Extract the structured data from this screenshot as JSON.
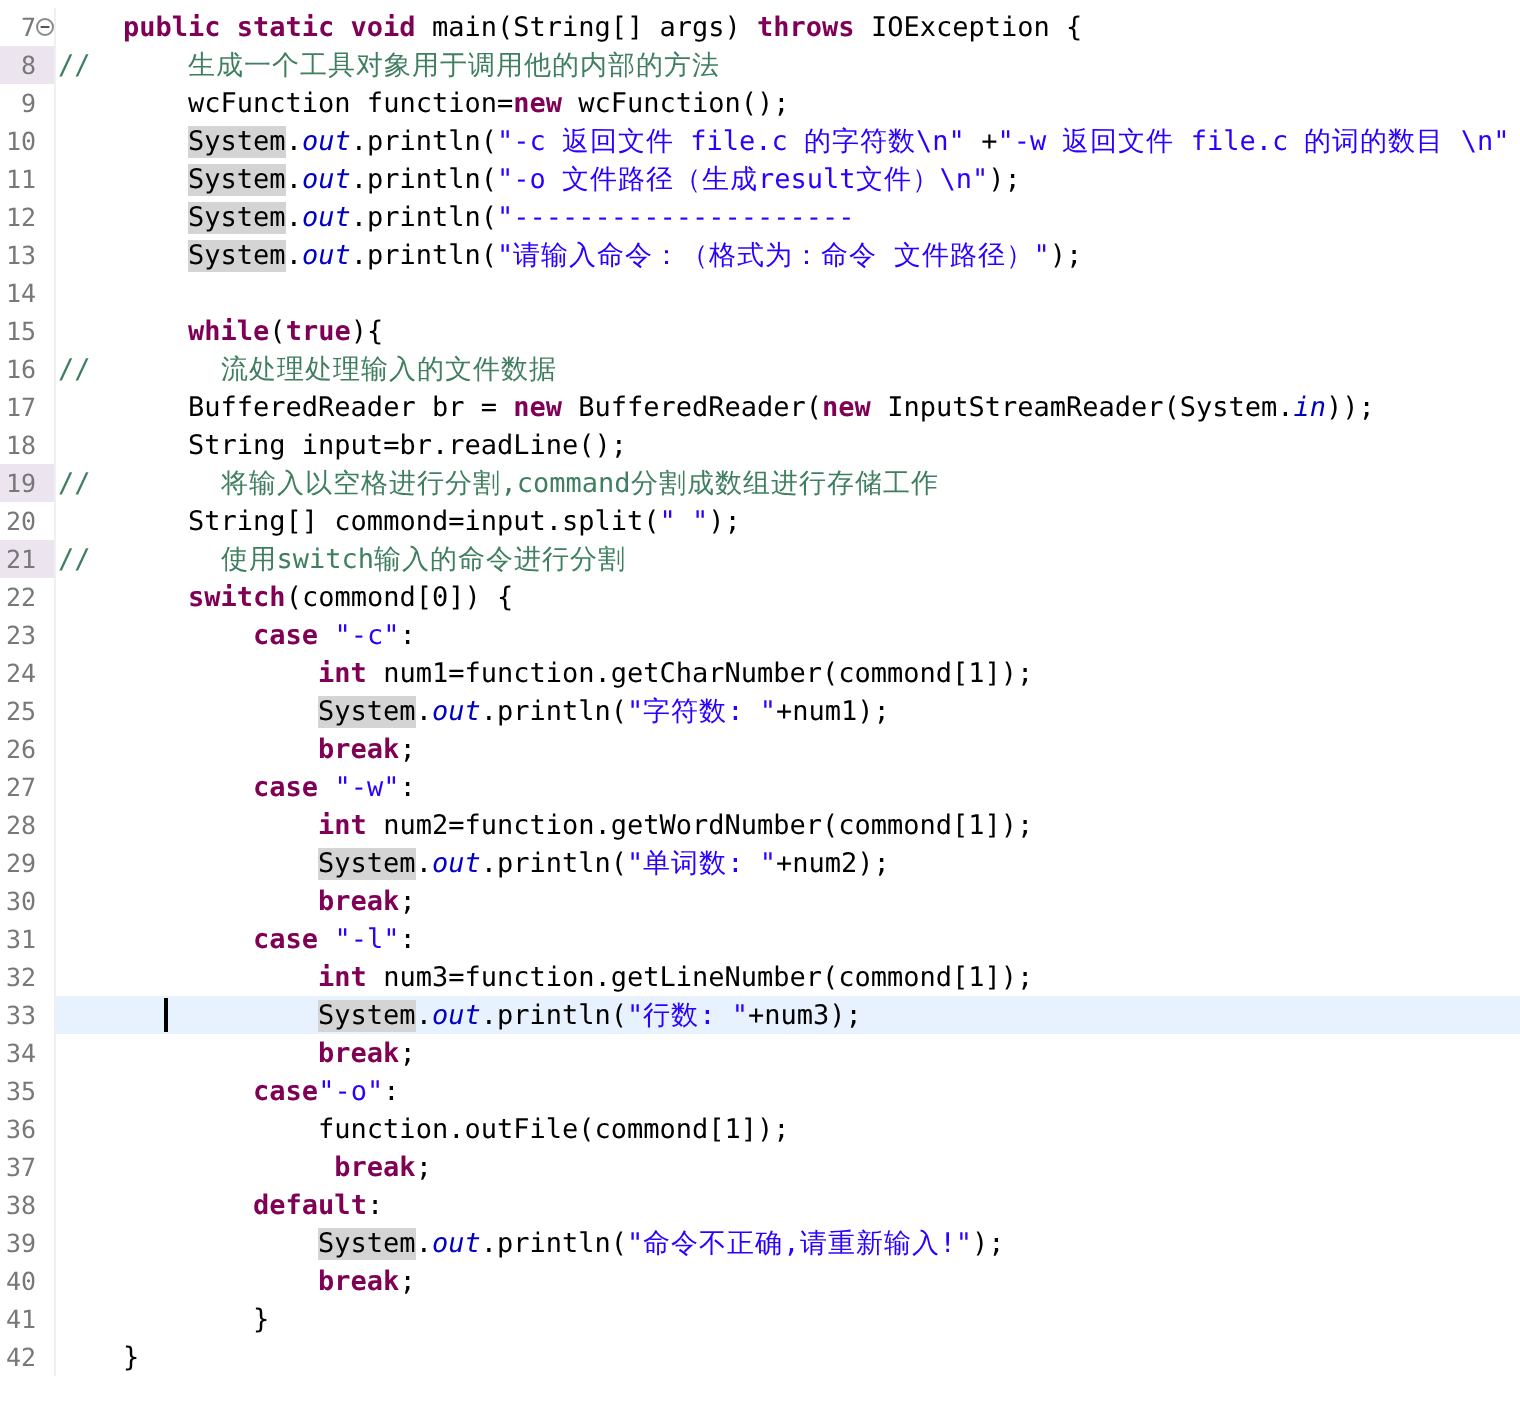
{
  "editor": {
    "lines": [
      {
        "number": "7",
        "current": false,
        "changed": false,
        "foldable": true,
        "tokens": [
          {
            "kind": "kw",
            "text": "    public static void"
          },
          {
            "kind": "plain",
            "text": " main(String[] args) "
          },
          {
            "kind": "kw",
            "text": "throws"
          },
          {
            "kind": "plain",
            "text": " IOException {"
          }
        ]
      },
      {
        "number": "8",
        "current": false,
        "changed": true,
        "foldable": false,
        "tokens": [
          {
            "kind": "comment",
            "text": "//      生成一个工具对象用于调用他的内部的方法"
          }
        ]
      },
      {
        "number": "9",
        "current": false,
        "changed": false,
        "foldable": false,
        "tokens": [
          {
            "kind": "plain",
            "text": "        wcFunction function="
          },
          {
            "kind": "kw",
            "text": "new"
          },
          {
            "kind": "plain",
            "text": " wcFunction();"
          }
        ]
      },
      {
        "number": "10",
        "current": false,
        "changed": false,
        "foldable": false,
        "tokens": [
          {
            "kind": "mark",
            "text": "        System"
          },
          {
            "kind": "plain",
            "text": "."
          },
          {
            "kind": "field",
            "text": "out"
          },
          {
            "kind": "plain",
            "text": ".println("
          },
          {
            "kind": "str",
            "text": "\"-c 返回文件 file.c 的字符数\\n\""
          },
          {
            "kind": "plain",
            "text": " +"
          },
          {
            "kind": "str",
            "text": "\"-w 返回文件 file.c 的词的数目 \\n\""
          }
        ]
      },
      {
        "number": "11",
        "current": false,
        "changed": false,
        "foldable": false,
        "tokens": [
          {
            "kind": "mark",
            "text": "        System"
          },
          {
            "kind": "plain",
            "text": "."
          },
          {
            "kind": "field",
            "text": "out"
          },
          {
            "kind": "plain",
            "text": ".println("
          },
          {
            "kind": "str",
            "text": "\"-o 文件路径（生成result文件）\\n\""
          },
          {
            "kind": "plain",
            "text": ");"
          }
        ]
      },
      {
        "number": "12",
        "current": false,
        "changed": false,
        "foldable": false,
        "tokens": [
          {
            "kind": "mark",
            "text": "        System"
          },
          {
            "kind": "plain",
            "text": "."
          },
          {
            "kind": "field",
            "text": "out"
          },
          {
            "kind": "plain",
            "text": ".println("
          },
          {
            "kind": "str",
            "text": "\"---------------------"
          }
        ]
      },
      {
        "number": "13",
        "current": false,
        "changed": false,
        "foldable": false,
        "tokens": [
          {
            "kind": "mark",
            "text": "        System"
          },
          {
            "kind": "plain",
            "text": "."
          },
          {
            "kind": "field",
            "text": "out"
          },
          {
            "kind": "plain",
            "text": ".println("
          },
          {
            "kind": "str",
            "text": "\"请输入命令：（格式为：命令 文件路径）\""
          },
          {
            "kind": "plain",
            "text": ");"
          }
        ]
      },
      {
        "number": "14",
        "current": false,
        "changed": false,
        "foldable": false
      },
      {
        "number": "15",
        "current": false,
        "changed": false,
        "foldable": false,
        "tokens": [
          {
            "kind": "kw",
            "text": "        while"
          },
          {
            "kind": "plain",
            "text": "("
          },
          {
            "kind": "kw",
            "text": "true"
          },
          {
            "kind": "plain",
            "text": "){"
          }
        ]
      },
      {
        "number": "16",
        "current": false,
        "changed": false,
        "foldable": false,
        "tokens": [
          {
            "kind": "comment",
            "text": "//        流处理处理输入的文件数据"
          }
        ]
      },
      {
        "number": "17",
        "current": false,
        "changed": false,
        "foldable": false,
        "tokens": [
          {
            "kind": "plain",
            "text": "        BufferedReader br = "
          },
          {
            "kind": "kw",
            "text": "new"
          },
          {
            "kind": "plain",
            "text": " BufferedReader("
          },
          {
            "kind": "kw",
            "text": "new"
          },
          {
            "kind": "plain",
            "text": " InputStreamReader(System."
          },
          {
            "kind": "field",
            "text": "in"
          },
          {
            "kind": "plain",
            "text": "));"
          }
        ]
      },
      {
        "number": "18",
        "current": false,
        "changed": false,
        "foldable": false,
        "tokens": [
          {
            "kind": "plain",
            "text": "        String input=br.readLine();"
          }
        ]
      },
      {
        "number": "19",
        "current": false,
        "changed": true,
        "foldable": false,
        "tokens": [
          {
            "kind": "comment",
            "text": "//        将输入以空格进行分割,command分割成数组进行存储工作"
          }
        ]
      },
      {
        "number": "20",
        "current": false,
        "changed": false,
        "foldable": false,
        "tokens": [
          {
            "kind": "plain",
            "text": "        String[] commond=input.split("
          },
          {
            "kind": "str",
            "text": "\" \""
          },
          {
            "kind": "plain",
            "text": ");"
          }
        ]
      },
      {
        "number": "21",
        "current": false,
        "changed": true,
        "foldable": false,
        "tokens": [
          {
            "kind": "comment",
            "text": "//        使用switch输入的命令进行分割"
          }
        ]
      },
      {
        "number": "22",
        "current": false,
        "changed": false,
        "foldable": false,
        "tokens": [
          {
            "kind": "kw",
            "text": "        switch"
          },
          {
            "kind": "plain",
            "text": "(commond[0]) {"
          }
        ]
      },
      {
        "number": "23",
        "current": false,
        "changed": false,
        "foldable": false,
        "tokens": [
          {
            "kind": "kw",
            "text": "            case"
          },
          {
            "kind": "str",
            "text": " \"-c\""
          },
          {
            "kind": "plain",
            "text": ":"
          }
        ]
      },
      {
        "number": "24",
        "current": false,
        "changed": false,
        "foldable": false,
        "tokens": [
          {
            "kind": "kw",
            "text": "                int"
          },
          {
            "kind": "plain",
            "text": " num1=function.getCharNumber(commond[1]);"
          }
        ]
      },
      {
        "number": "25",
        "current": false,
        "changed": false,
        "foldable": false,
        "tokens": [
          {
            "kind": "mark",
            "text": "                System"
          },
          {
            "kind": "plain",
            "text": "."
          },
          {
            "kind": "field",
            "text": "out"
          },
          {
            "kind": "plain",
            "text": ".println("
          },
          {
            "kind": "str",
            "text": "\"字符数: \""
          },
          {
            "kind": "plain",
            "text": "+num1);"
          }
        ]
      },
      {
        "number": "26",
        "current": false,
        "changed": false,
        "foldable": false,
        "tokens": [
          {
            "kind": "kw",
            "text": "                break"
          },
          {
            "kind": "plain",
            "text": ";"
          }
        ]
      },
      {
        "number": "27",
        "current": false,
        "changed": false,
        "foldable": false,
        "tokens": [
          {
            "kind": "kw",
            "text": "            case"
          },
          {
            "kind": "str",
            "text": " \"-w\""
          },
          {
            "kind": "plain",
            "text": ":"
          }
        ]
      },
      {
        "number": "28",
        "current": false,
        "changed": false,
        "foldable": false,
        "tokens": [
          {
            "kind": "kw",
            "text": "                int"
          },
          {
            "kind": "plain",
            "text": " num2=function.getWordNumber(commond[1]);"
          }
        ]
      },
      {
        "number": "29",
        "current": false,
        "changed": false,
        "foldable": false,
        "tokens": [
          {
            "kind": "mark",
            "text": "                System"
          },
          {
            "kind": "plain",
            "text": "."
          },
          {
            "kind": "field",
            "text": "out"
          },
          {
            "kind": "plain",
            "text": ".println("
          },
          {
            "kind": "str",
            "text": "\"单词数: \""
          },
          {
            "kind": "plain",
            "text": "+num2);"
          }
        ]
      },
      {
        "number": "30",
        "current": false,
        "changed": false,
        "foldable": false,
        "tokens": [
          {
            "kind": "kw",
            "text": "                break"
          },
          {
            "kind": "plain",
            "text": ";"
          }
        ]
      },
      {
        "number": "31",
        "current": false,
        "changed": false,
        "foldable": false,
        "tokens": [
          {
            "kind": "kw",
            "text": "            case"
          },
          {
            "kind": "str",
            "text": " \"-l\""
          },
          {
            "kind": "plain",
            "text": ":"
          }
        ]
      },
      {
        "number": "32",
        "current": false,
        "changed": false,
        "foldable": false,
        "tokens": [
          {
            "kind": "kw",
            "text": "                int"
          },
          {
            "kind": "plain",
            "text": " num3=function.getLineNumber(commond[1]);"
          }
        ]
      },
      {
        "number": "33",
        "current": true,
        "changed": false,
        "foldable": false,
        "tokens": [
          {
            "kind": "mark",
            "text": "                System"
          },
          {
            "kind": "plain",
            "text": "."
          },
          {
            "kind": "field",
            "text": "out"
          },
          {
            "kind": "plain",
            "text": ".println("
          },
          {
            "kind": "str",
            "text": "\"行数: \""
          },
          {
            "kind": "plain",
            "text": "+num3);"
          }
        ]
      },
      {
        "number": "34",
        "current": false,
        "changed": false,
        "foldable": false,
        "tokens": [
          {
            "kind": "kw",
            "text": "                break"
          },
          {
            "kind": "plain",
            "text": ";"
          }
        ]
      },
      {
        "number": "35",
        "current": false,
        "changed": false,
        "foldable": false,
        "tokens": [
          {
            "kind": "kw",
            "text": "            case"
          },
          {
            "kind": "str",
            "text": "\"-o\""
          },
          {
            "kind": "plain",
            "text": ":"
          }
        ]
      },
      {
        "number": "36",
        "current": false,
        "changed": false,
        "foldable": false,
        "tokens": [
          {
            "kind": "plain",
            "text": "                function.outFile(commond[1]);"
          }
        ]
      },
      {
        "number": "37",
        "current": false,
        "changed": false,
        "foldable": false,
        "tokens": [
          {
            "kind": "kw",
            "text": "                 break"
          },
          {
            "kind": "plain",
            "text": ";"
          }
        ]
      },
      {
        "number": "38",
        "current": false,
        "changed": false,
        "foldable": false,
        "tokens": [
          {
            "kind": "kw",
            "text": "            default"
          },
          {
            "kind": "plain",
            "text": ":"
          }
        ]
      },
      {
        "number": "39",
        "current": false,
        "changed": false,
        "foldable": false,
        "tokens": [
          {
            "kind": "mark",
            "text": "                System"
          },
          {
            "kind": "plain",
            "text": "."
          },
          {
            "kind": "field",
            "text": "out"
          },
          {
            "kind": "plain",
            "text": ".println("
          },
          {
            "kind": "str",
            "text": "\"命令不正确,请重新输入!\""
          },
          {
            "kind": "plain",
            "text": ");"
          }
        ]
      },
      {
        "number": "40",
        "current": false,
        "changed": false,
        "foldable": false,
        "tokens": [
          {
            "kind": "kw",
            "text": "                break"
          },
          {
            "kind": "plain",
            "text": ";"
          }
        ]
      },
      {
        "number": "41",
        "current": false,
        "changed": false,
        "foldable": false,
        "tokens": [
          {
            "kind": "plain",
            "text": "            }"
          }
        ]
      },
      {
        "number": "42",
        "current": false,
        "changed": false,
        "foldable": false,
        "tokens": [
          {
            "kind": "plain",
            "text": "    }"
          }
        ]
      }
    ]
  }
}
